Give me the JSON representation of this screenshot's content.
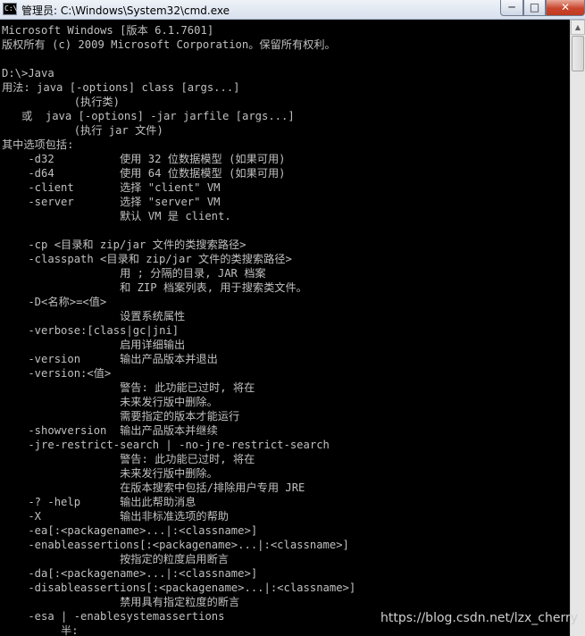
{
  "window": {
    "title": "管理员: C:\\Windows\\System32\\cmd.exe",
    "icon_label": "C:\\",
    "min_symbol": "─",
    "max_symbol": "□",
    "close_symbol": "✕"
  },
  "console": {
    "lines": [
      "Microsoft Windows [版本 6.1.7601]",
      "版权所有 (c) 2009 Microsoft Corporation。保留所有权利。",
      "",
      "D:\\>Java",
      "用法: java [-options] class [args...]",
      "           (执行类)",
      "   或  java [-options] -jar jarfile [args...]",
      "           (执行 jar 文件)",
      "其中选项包括:",
      "    -d32          使用 32 位数据模型 (如果可用)",
      "    -d64          使用 64 位数据模型 (如果可用)",
      "    -client       选择 \"client\" VM",
      "    -server       选择 \"server\" VM",
      "                  默认 VM 是 client.",
      "",
      "    -cp <目录和 zip/jar 文件的类搜索路径>",
      "    -classpath <目录和 zip/jar 文件的类搜索路径>",
      "                  用 ; 分隔的目录, JAR 档案",
      "                  和 ZIP 档案列表, 用于搜索类文件。",
      "    -D<名称>=<值>",
      "                  设置系统属性",
      "    -verbose:[class|gc|jni]",
      "                  启用详细输出",
      "    -version      输出产品版本并退出",
      "    -version:<值>",
      "                  警告: 此功能已过时, 将在",
      "                  未来发行版中删除。",
      "                  需要指定的版本才能运行",
      "    -showversion  输出产品版本并继续",
      "    -jre-restrict-search | -no-jre-restrict-search",
      "                  警告: 此功能已过时, 将在",
      "                  未来发行版中删除。",
      "                  在版本搜索中包括/排除用户专用 JRE",
      "    -? -help      输出此帮助消息",
      "    -X            输出非标准选项的帮助",
      "    -ea[:<packagename>...|:<classname>]",
      "    -enableassertions[:<packagename>...|:<classname>]",
      "                  按指定的粒度启用断言",
      "    -da[:<packagename>...|:<classname>]",
      "    -disableassertions[:<packagename>...|:<classname>]",
      "                  禁用具有指定粒度的断言",
      "    -esa | -enablesystemassertions",
      "         半:"
    ]
  },
  "watermark": "https://blog.csdn.net/lzx_cherry",
  "colors": {
    "console_bg": "#000000",
    "console_text": "#c0c0c0",
    "close_button": "#c9462c"
  }
}
